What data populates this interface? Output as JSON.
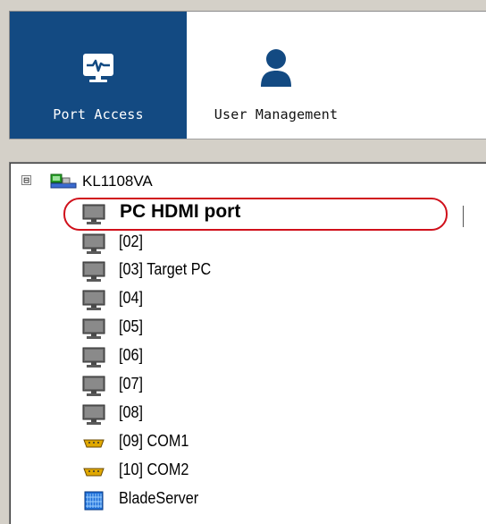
{
  "toolbar": {
    "buttons": [
      {
        "label": "Port Access",
        "icon": "monitor-pulse-icon",
        "active": true
      },
      {
        "label": "User Management",
        "icon": "user-icon",
        "active": false
      }
    ],
    "active_color": "#134a82"
  },
  "tree": {
    "root": {
      "expander": "⊟",
      "label": "KL1108VA",
      "icon": "network-device-icon"
    },
    "items": [
      {
        "label": "PC HDMI port",
        "icon": "monitor-icon",
        "highlighted": true
      },
      {
        "label": "[02]",
        "icon": "monitor-icon"
      },
      {
        "label": "[03] Target PC",
        "icon": "monitor-icon"
      },
      {
        "label": "[04]",
        "icon": "monitor-icon"
      },
      {
        "label": "[05]",
        "icon": "monitor-icon"
      },
      {
        "label": "[06]",
        "icon": "monitor-icon"
      },
      {
        "label": "[07]",
        "icon": "monitor-icon"
      },
      {
        "label": "[08]",
        "icon": "monitor-icon"
      },
      {
        "label": "[09] COM1",
        "icon": "serial-port-icon"
      },
      {
        "label": "[10] COM2",
        "icon": "serial-port-icon"
      },
      {
        "label": "BladeServer",
        "icon": "blade-server-icon"
      }
    ],
    "highlight_color": "#d0101b"
  }
}
